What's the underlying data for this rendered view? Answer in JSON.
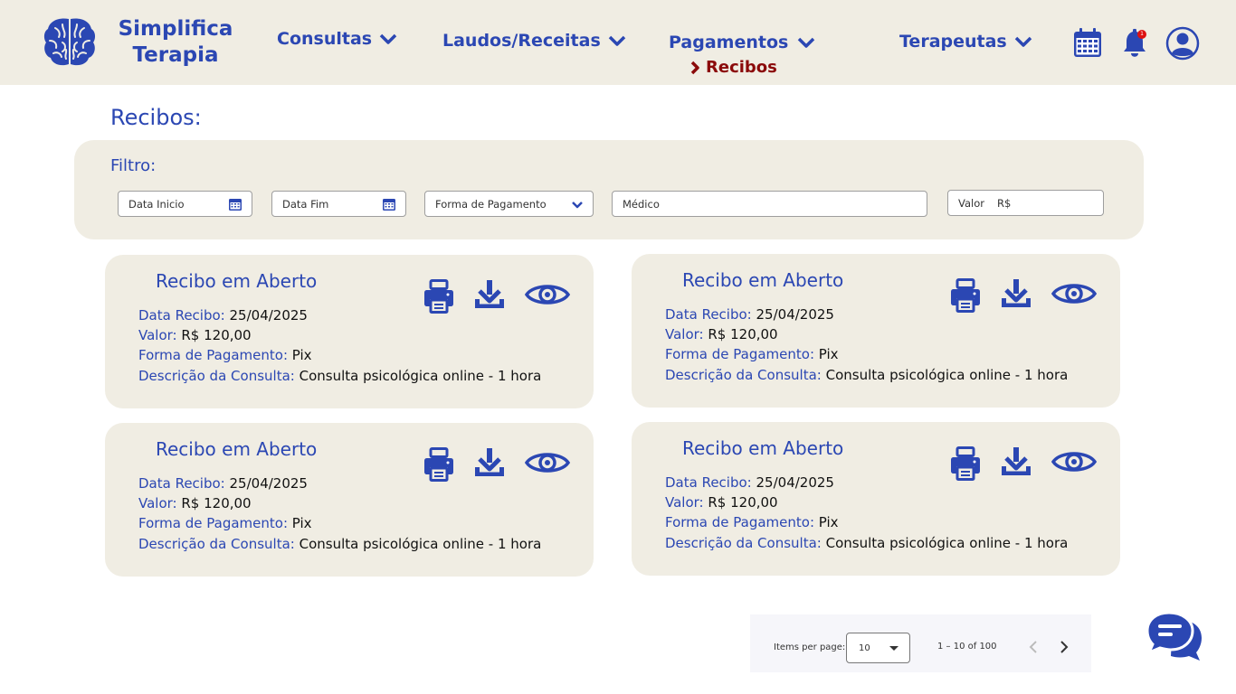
{
  "brand": {
    "line1": "Simplifica",
    "line2": "Terapia"
  },
  "nav": {
    "consultas": "Consultas",
    "laudos": "Laudos/Receitas",
    "pagamentos": "Pagamentos",
    "recibos": "Recibos",
    "terapeutas": "Terapeutas"
  },
  "header_icons": [
    "calendar-icon",
    "bell-icon",
    "user-avatar-icon"
  ],
  "notification_count": "1",
  "page": {
    "title": "Recibos:"
  },
  "filter": {
    "label": "Filtro:",
    "data_inicio": "Data Inicio",
    "data_fim": "Data Fim",
    "forma_pagamento": "Forma de Pagamento",
    "medico": "Médico",
    "valor": "Valor",
    "valor_prefix": "R$"
  },
  "card_labels": {
    "data": "Data Recibo:",
    "valor": "Valor:",
    "forma": "Forma de Pagamento:",
    "descricao": "Descrição da Consulta:"
  },
  "receipts": [
    {
      "title": "Recibo em Aberto",
      "data": "25/04/2025",
      "valor": "R$ 120,00",
      "forma": "Pix",
      "descricao": "Consulta psicológica online - 1 hora"
    },
    {
      "title": "Recibo em Aberto",
      "data": "25/04/2025",
      "valor": "R$ 120,00",
      "forma": "Pix",
      "descricao": "Consulta psicológica online - 1 hora"
    },
    {
      "title": "Recibo em Aberto",
      "data": "25/04/2025",
      "valor": "R$ 120,00",
      "forma": "Pix",
      "descricao": "Consulta psicológica online - 1 hora"
    },
    {
      "title": "Recibo em Aberto",
      "data": "25/04/2025",
      "valor": "R$ 120,00",
      "forma": "Pix",
      "descricao": "Consulta psicológica online - 1 hora"
    }
  ],
  "paginator": {
    "items_label": "Items per page:",
    "page_size": "10",
    "range": "1 – 10 of 100"
  },
  "colors": {
    "primary": "#2b47b3",
    "accent": "#8b0a0a",
    "panel": "#f0ede3"
  }
}
